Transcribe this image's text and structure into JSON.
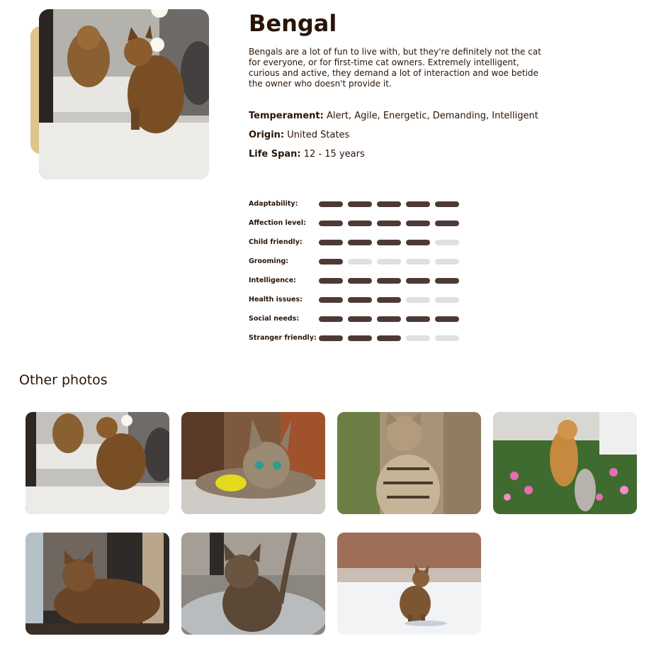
{
  "breed": {
    "name": "Bengal",
    "description": "Bengals are a lot of fun to live with, but they're definitely not the cat for everyone, or for first-time cat owners. Extremely intelligent, curious and active, they demand a lot of interaction and woe betide the owner who doesn't provide it.",
    "temperament_label": "Temperament:",
    "temperament": "Alert, Agile, Energetic, Demanding, Intelligent",
    "origin_label": "Origin:",
    "origin": "United States",
    "life_span_label": "Life Span:",
    "life_span": "12 - 15 years"
  },
  "ratings": [
    {
      "label": "Adaptability:",
      "value": 5
    },
    {
      "label": "Affection level:",
      "value": 5
    },
    {
      "label": "Child friendly:",
      "value": 4
    },
    {
      "label": "Grooming:",
      "value": 1
    },
    {
      "label": "Intelligence:",
      "value": 5
    },
    {
      "label": "Health issues:",
      "value": 3
    },
    {
      "label": "Social needs:",
      "value": 5
    },
    {
      "label": "Stranger friendly:",
      "value": 3
    }
  ],
  "other_photos": {
    "title": "Other photos"
  },
  "colors": {
    "text": "#291507",
    "accent": "#DEC68B",
    "bar_on": "#4D3A35",
    "bar_off": "#E0E0E0"
  }
}
